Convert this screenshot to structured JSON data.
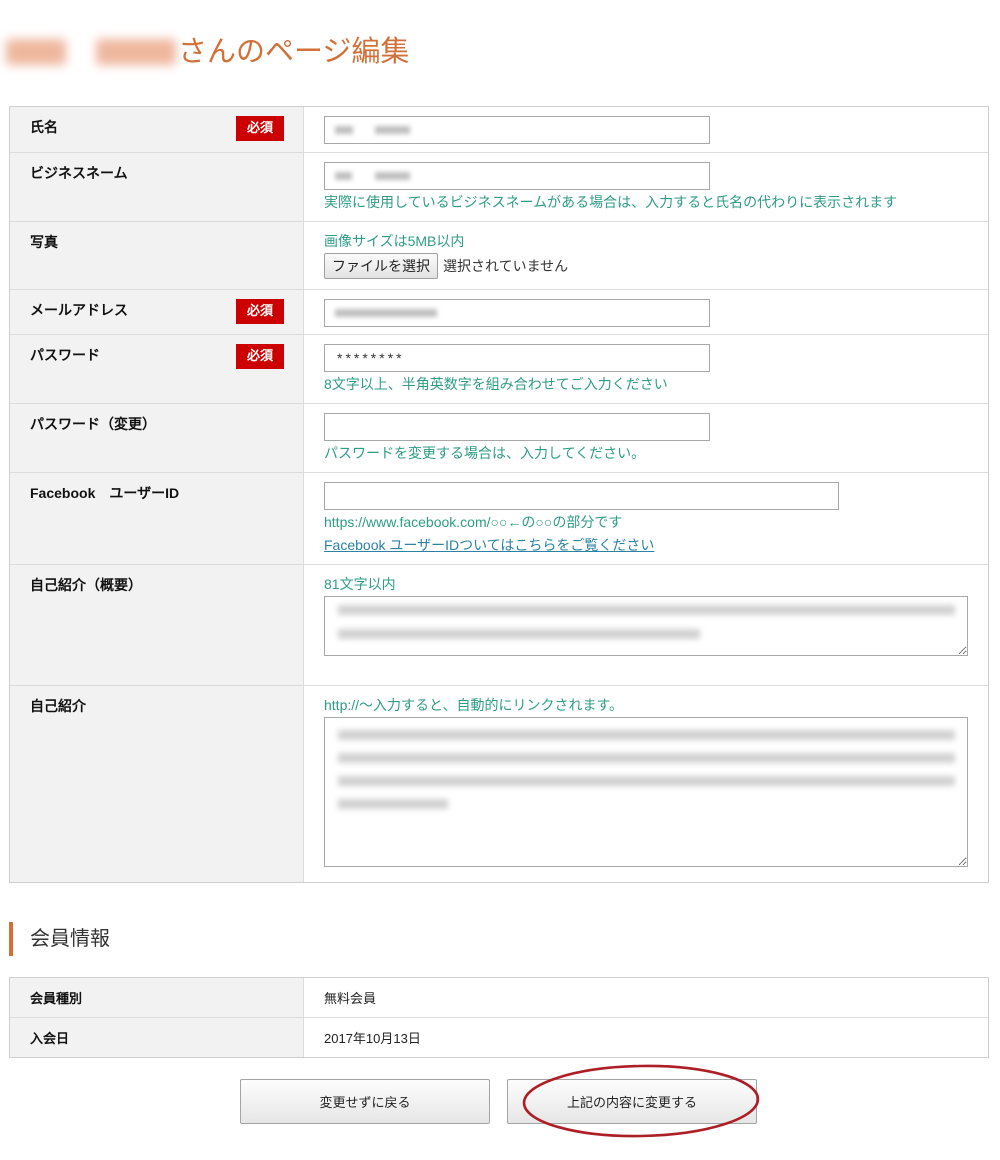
{
  "page": {
    "title_suffix": "さんのページ編集"
  },
  "form": {
    "required_badge": "必須"
  },
  "fields": {
    "name": {
      "label": "氏名"
    },
    "business_name": {
      "label": "ビジネスネーム",
      "help": "実際に使用しているビジネスネームがある場合は、入力すると氏名の代わりに表示されます"
    },
    "photo": {
      "label": "写真",
      "help": "画像サイズは5MB以内",
      "button": "ファイルを選択",
      "status": "選択されていません"
    },
    "email": {
      "label": "メールアドレス"
    },
    "password": {
      "label": "パスワード",
      "value": "********",
      "help": "8文字以上、半角英数字を組み合わせてご入力ください"
    },
    "password_change": {
      "label": "パスワード（変更）",
      "help": "パスワードを変更する場合は、入力してください。"
    },
    "facebook_id": {
      "label": "Facebook　ユーザーID",
      "help": "https://www.facebook.com/○○←の○○の部分です",
      "link": "Facebook ユーザーIDついてはこちらをご覧ください"
    },
    "intro_summary": {
      "label": "自己紹介（概要）",
      "help": "81文字以内"
    },
    "intro": {
      "label": "自己紹介",
      "help": "http://～入力すると、自動的にリンクされます。"
    }
  },
  "membership": {
    "heading": "会員情報",
    "rows": [
      {
        "label": "会員種別",
        "value": "無料会員"
      },
      {
        "label": "入会日",
        "value": "2017年10月13日"
      }
    ]
  },
  "actions": {
    "back_label": "変更せずに戻る",
    "submit_label": "上記の内容に変更する"
  },
  "colors": {
    "title": "#d2703a",
    "help_text": "#2e9c87",
    "link": "#2b82a5",
    "required_badge": "#cc0000",
    "section_bar": "#d2703a",
    "annotation": "#ad1f26"
  }
}
